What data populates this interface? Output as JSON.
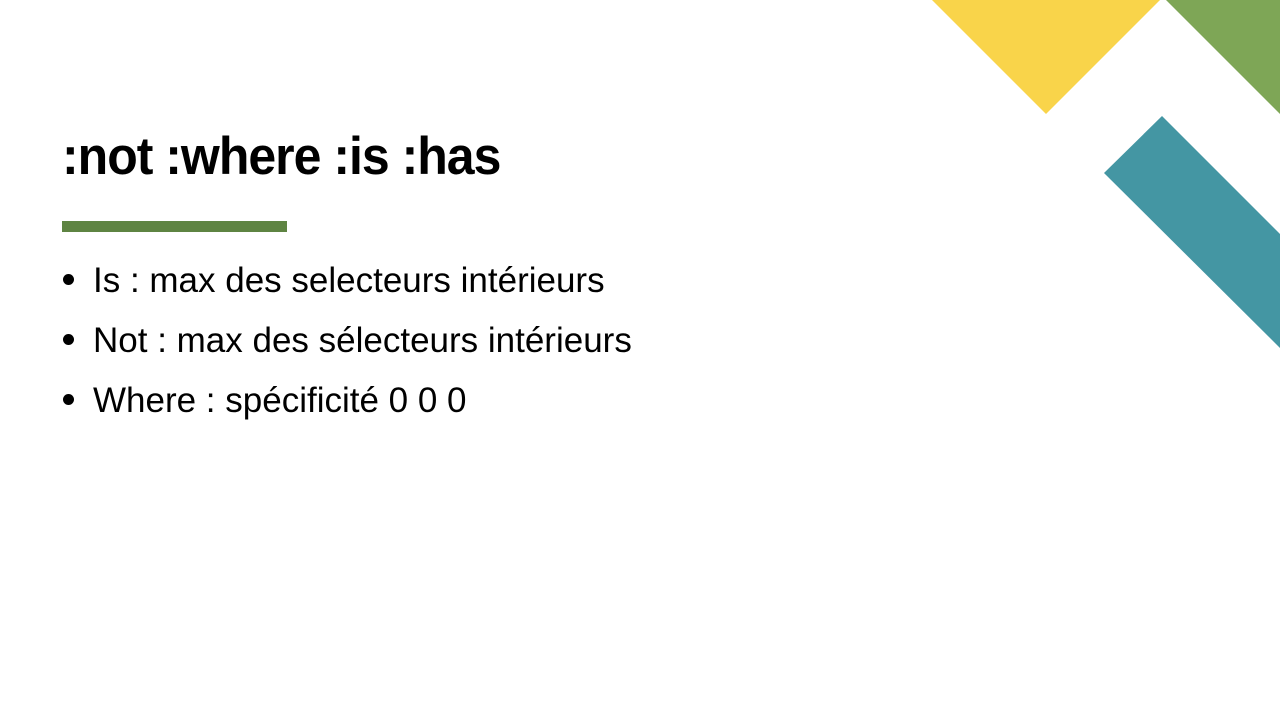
{
  "slide": {
    "title": ":not :where :is :has",
    "bullets": [
      "Is : max des selecteurs intérieurs",
      "Not : max des sélecteurs intérieurs",
      "Where : spécificité 0 0 0"
    ]
  },
  "colors": {
    "accent_green": "#5e8442",
    "deco_yellow": "#f9d44a",
    "deco_green": "#7ea656",
    "deco_teal": "#4496a3",
    "text": "#000000",
    "background": "#ffffff"
  }
}
